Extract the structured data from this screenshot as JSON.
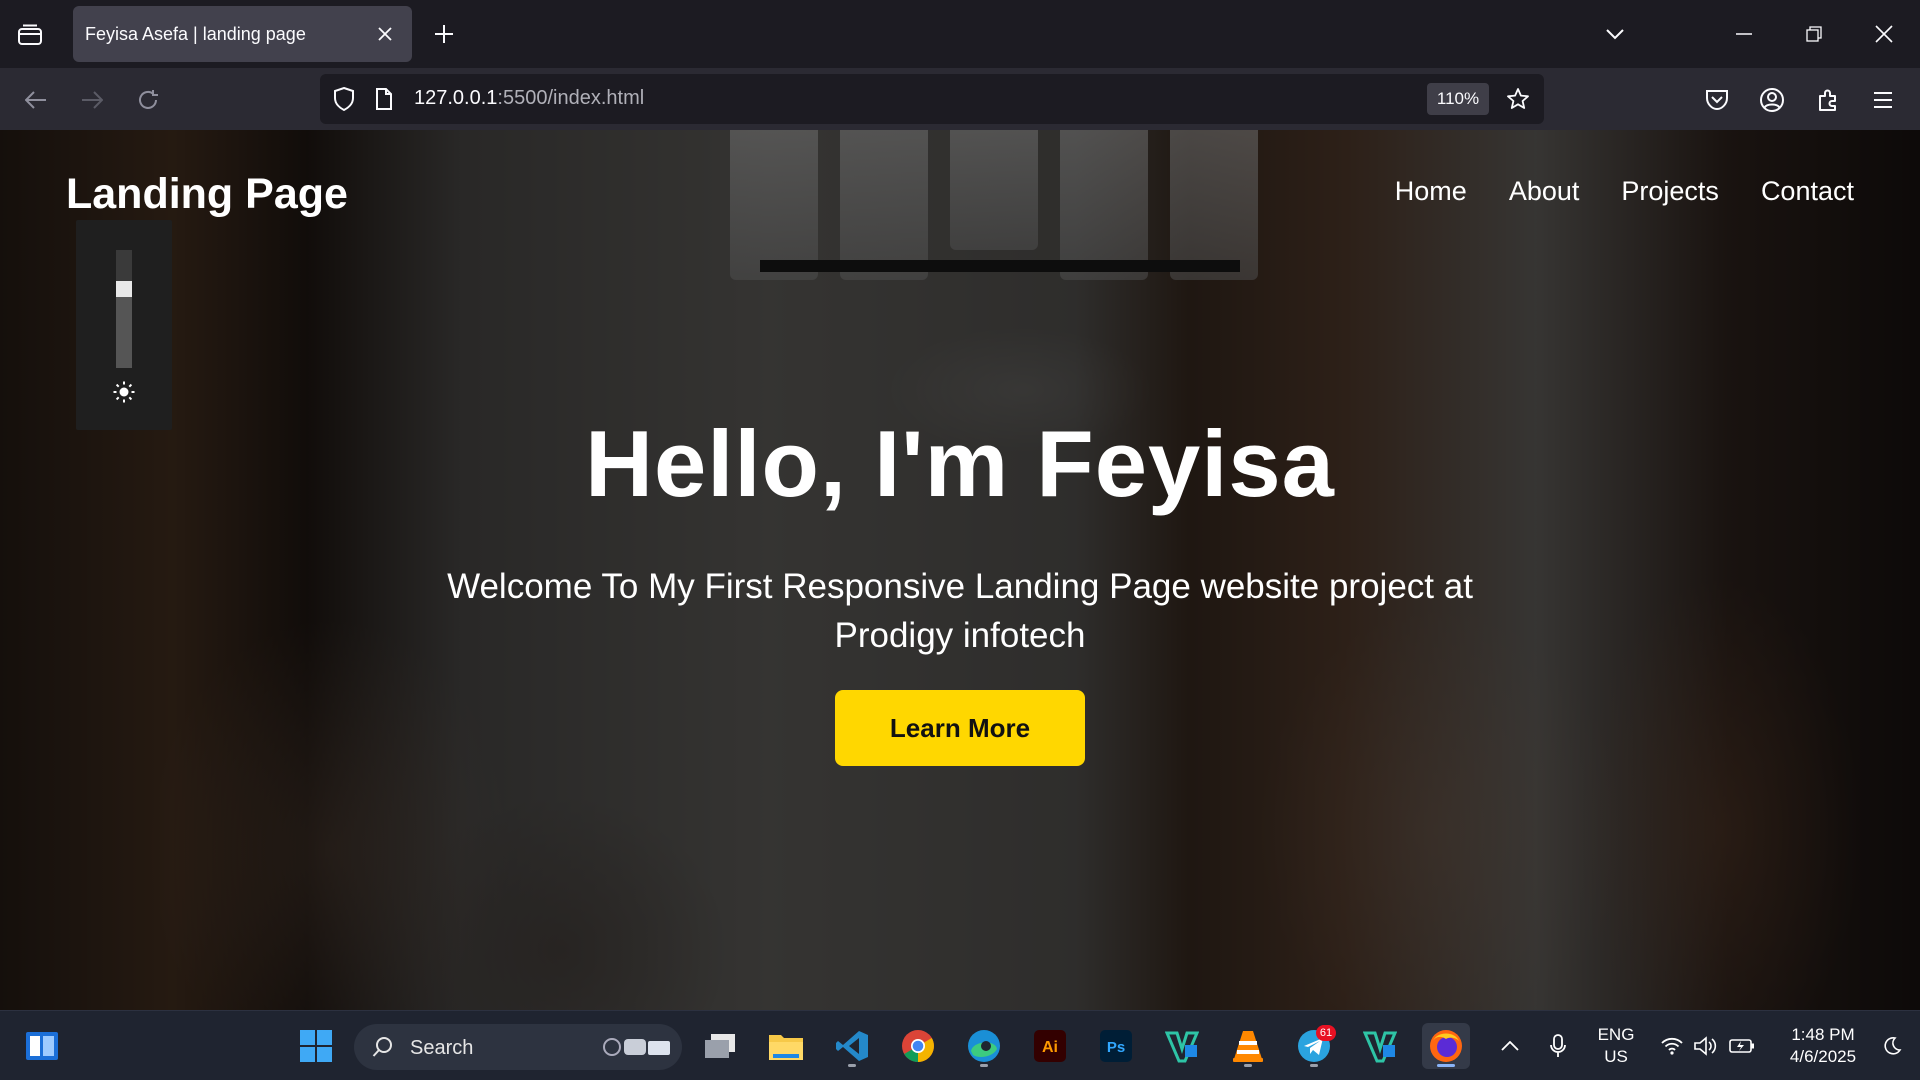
{
  "browser": {
    "tab_title": "Feyisa Asefa | landing page",
    "url_host": "127.0.0.1",
    "url_path": ":5500/index.html",
    "zoom": "110%"
  },
  "site": {
    "logo": "Landing Page",
    "nav": [
      "Home",
      "About",
      "Projects",
      "Contact"
    ],
    "hero_title": "Hello, I'm Feyisa",
    "hero_subtitle": "Welcome To My First Responsive Landing Page website project at Prodigy infotech",
    "cta_label": "Learn More",
    "cta_color": "#ffd700"
  },
  "brightness_popup": {
    "level": 0.7,
    "icon": "sun-icon"
  },
  "taskbar": {
    "search_label": "Search",
    "apps": [
      "widgets",
      "start",
      "task-view",
      "file-explorer",
      "vs-code",
      "chrome",
      "edge",
      "illustrator",
      "photoshop",
      "vs-code-variant",
      "vlc",
      "telegram",
      "vs-code-variant",
      "firefox"
    ],
    "telegram_badge": "61",
    "language": "ENG",
    "region": "US",
    "time": "1:48 PM",
    "date": "4/6/2025"
  },
  "colors": {
    "chrome_bg": "#1c1b22",
    "toolbar_bg": "#2b2a33",
    "taskbar_bg": "#1f2430",
    "accent": "#ffd700"
  }
}
